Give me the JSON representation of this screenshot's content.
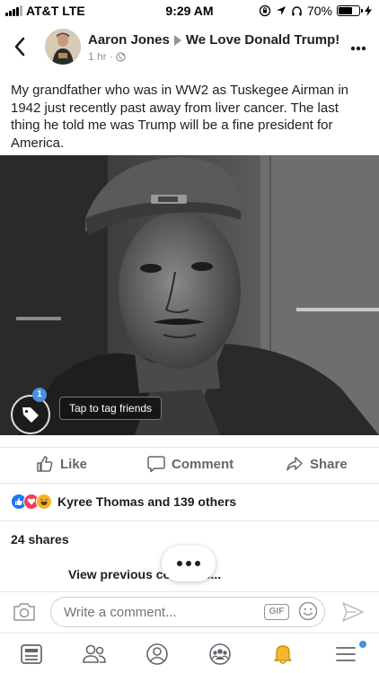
{
  "status_bar": {
    "carrier": "AT&T",
    "network": "LTE",
    "time": "9:29 AM",
    "battery_percent": "70%",
    "battery_level": 0.7
  },
  "post": {
    "author": "Aaron Jones",
    "group": "We Love Donald Trump!",
    "time_ago": "1 hr ·",
    "text": "My grandfather who was in WW2 as Tuskegee Airman in 1942 just recently past away from liver cancer. The last thing he told me was Trump will be a fine president for America.",
    "tag_badge_count": "1",
    "tag_tooltip": "Tap to tag friends"
  },
  "actions": {
    "like": "Like",
    "comment": "Comment",
    "share": "Share"
  },
  "reactions": {
    "label": "Kyree Thomas and 139 others",
    "colors": {
      "like": "#1877f2",
      "love": "#f33e58",
      "haha": "#f7b125"
    }
  },
  "shares": {
    "label": "24 shares"
  },
  "comments": {
    "view_previous": "View previous co…   …ts..."
  },
  "composer": {
    "placeholder": "Write a comment...",
    "gif_label": "GIF"
  },
  "tabbar": {
    "items": [
      "news-feed-icon",
      "friends-icon",
      "profile-icon",
      "groups-icon",
      "notifications-icon",
      "menu-icon"
    ]
  }
}
